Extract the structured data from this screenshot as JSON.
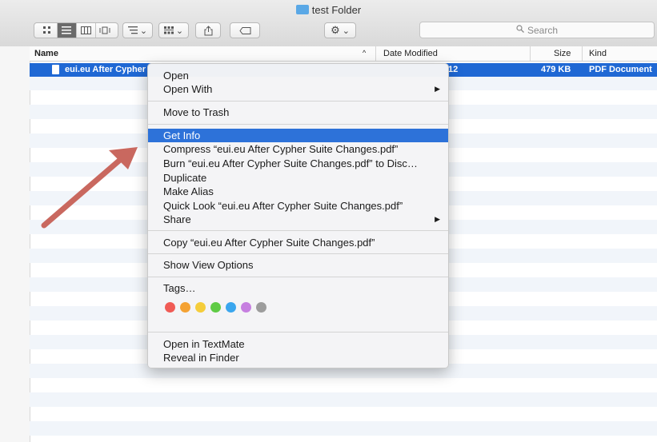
{
  "window": {
    "title": "test Folder"
  },
  "toolbar": {
    "view_icons": [
      "icon-view-icon",
      "list-view-icon",
      "column-view-icon",
      "coverflow-view-icon"
    ],
    "arrange_caret": "⌄",
    "group_caret": "⌄",
    "action_caret": "⌄"
  },
  "search": {
    "placeholder": "Search"
  },
  "columns": {
    "name": "Name",
    "sort_indicator": "^",
    "date_modified": "Date Modified",
    "size": "Size",
    "kind": "Kind"
  },
  "file_row": {
    "name": "eui.eu After Cypher",
    "date_fragment": "12",
    "size": "479 KB",
    "kind": "PDF Document"
  },
  "context_menu": {
    "open": "Open",
    "open_with": "Open With",
    "move_to_trash": "Move to Trash",
    "get_info": "Get Info",
    "compress": "Compress “eui.eu After Cypher Suite Changes.pdf”",
    "burn": "Burn “eui.eu After Cypher Suite Changes.pdf” to Disc…",
    "duplicate": "Duplicate",
    "make_alias": "Make Alias",
    "quick_look": "Quick Look “eui.eu After Cypher Suite Changes.pdf”",
    "share": "Share",
    "copy": "Copy “eui.eu After Cypher Suite Changes.pdf”",
    "show_view_options": "Show View Options",
    "tags": "Tags…",
    "open_in_textmate": "Open in TextMate",
    "reveal_in_finder": "Reveal in Finder",
    "submenu_arrow": "▶"
  },
  "tag_colors": [
    "#f05b55",
    "#f4a233",
    "#f5cd3b",
    "#5fcb45",
    "#3aa6ee",
    "#c67fe0",
    "#9c9c9c"
  ],
  "annotation": {
    "arrow_color": "#c9685f"
  }
}
